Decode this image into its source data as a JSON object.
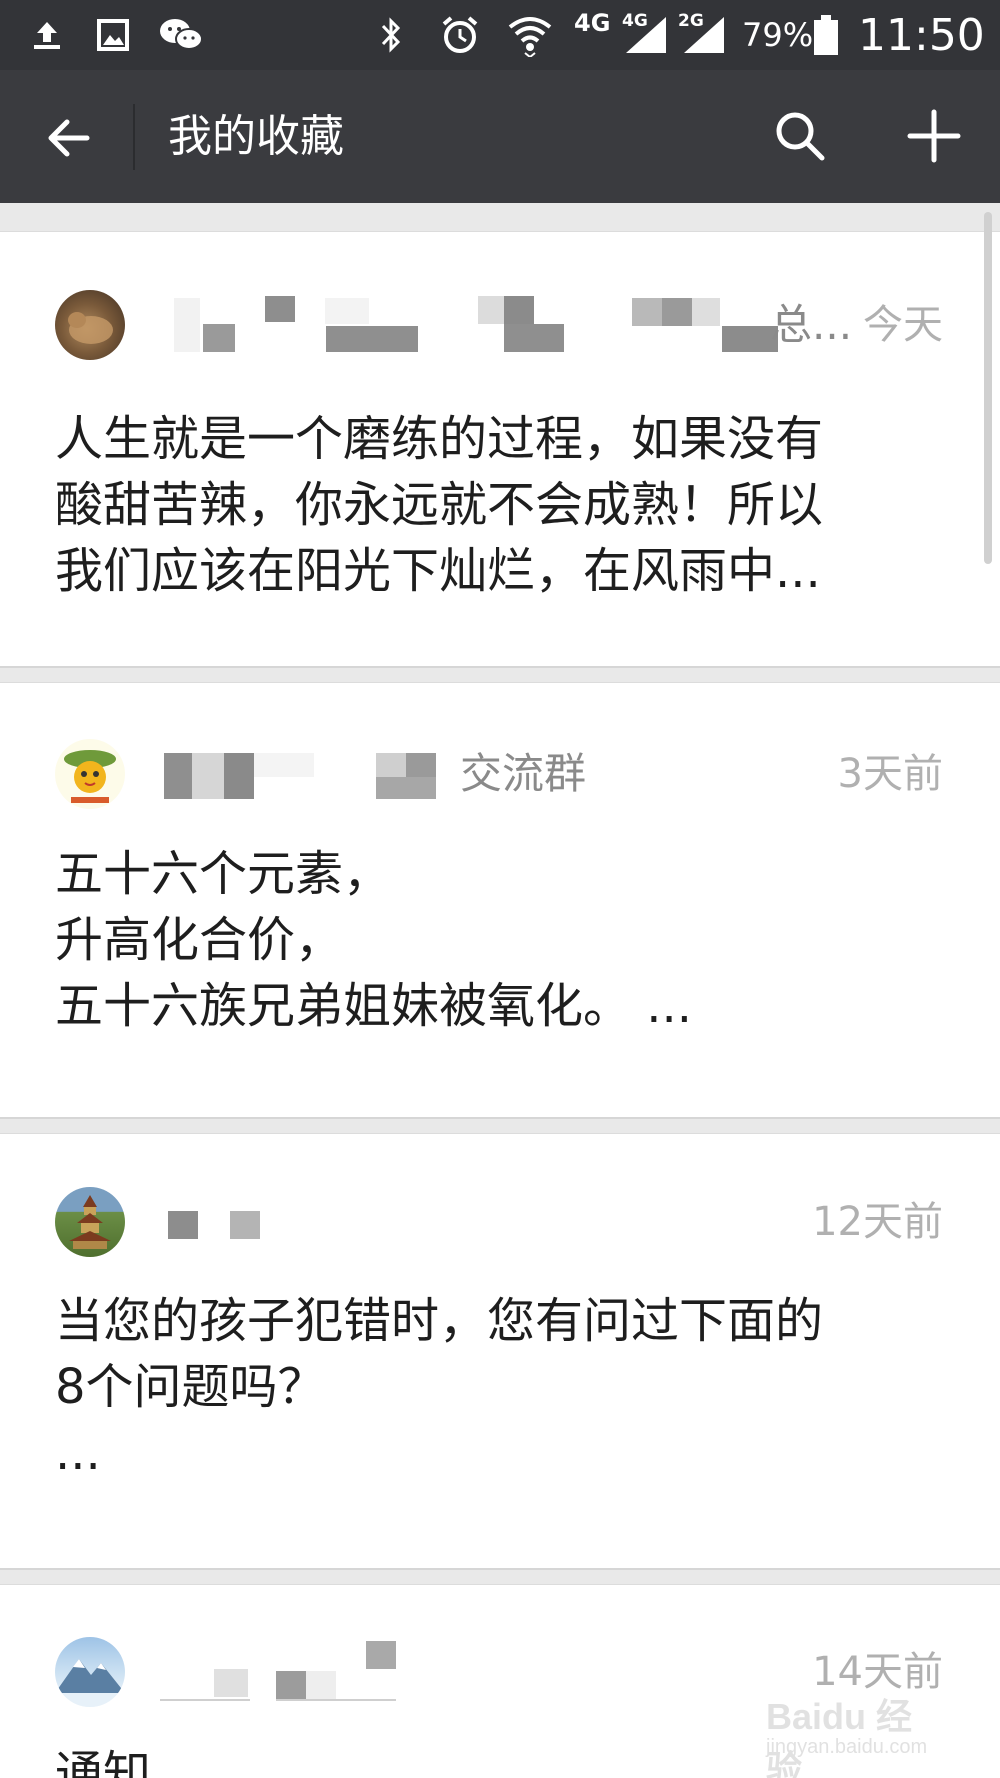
{
  "status_bar": {
    "network_label": "4G",
    "signal1_label": "4G",
    "signal2_label": "2G",
    "battery": "79%",
    "time": "11:50",
    "icons": [
      "upload-icon",
      "image-icon",
      "wechat-icon",
      "bluetooth-icon",
      "alarm-icon",
      "wifi-icon",
      "signal-icon",
      "battery-icon"
    ]
  },
  "header": {
    "title": "我的收藏",
    "back_icon": "back-arrow-icon",
    "search_icon": "search-icon",
    "add_icon": "plus-icon"
  },
  "favorites": [
    {
      "source_suffix": "总...",
      "time": "今天",
      "lines": [
        "人生就是一个磨练的过程，如果没有",
        "酸甜苦辣，你永远就不会成熟！所以",
        "我们应该在阳光下灿烂，在风雨中..."
      ]
    },
    {
      "source_suffix": "交流群",
      "time": "3天前",
      "lines": [
        "五十六个元素，",
        "升高化合价，",
        "五十六族兄弟姐妹被氧化。 ..."
      ]
    },
    {
      "source_suffix": "",
      "time": "12天前",
      "lines": [
        "当您的孩子犯错时，您有问过下面的",
        "8个问题吗？",
        "..."
      ]
    },
    {
      "source_suffix": "",
      "time": "14天前",
      "lines": [
        "通知"
      ]
    }
  ],
  "watermark": {
    "brand": "Baidu 经验",
    "url": "jingyan.baidu.com"
  }
}
